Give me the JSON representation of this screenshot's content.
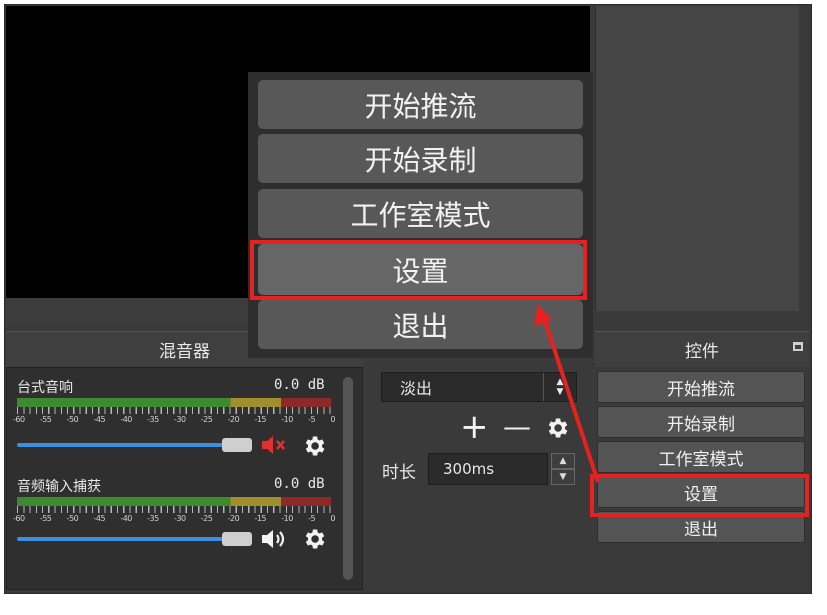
{
  "mixer": {
    "title": "混音器",
    "channels": [
      {
        "name": "台式音响",
        "db": "0.0 dB",
        "muted": true
      },
      {
        "name": "音频输入捕获",
        "db": "0.0 dB",
        "muted": false
      }
    ],
    "scale_labels": [
      "-60",
      "-55",
      "-50",
      "-45",
      "-40",
      "-35",
      "-30",
      "-25",
      "-20",
      "-15",
      "-10",
      "-5",
      "0"
    ]
  },
  "transitions": {
    "selected": "淡出",
    "add_label": "+",
    "remove_label": "—",
    "duration_label": "时长",
    "duration_value": "300ms"
  },
  "controls": {
    "title": "控件",
    "buttons": [
      "开始推流",
      "开始录制",
      "工作室模式",
      "设置",
      "退出"
    ],
    "highlighted": "设置"
  },
  "popup_menu": {
    "buttons": [
      "开始推流",
      "开始录制",
      "工作室模式",
      "设置",
      "退出"
    ],
    "highlighted": "设置"
  },
  "colors": {
    "annotation_red": "#e8201f",
    "volume_blue": "#3a8fe0",
    "mute_red": "#e03030"
  },
  "icons": [
    "mute-speaker-icon",
    "speaker-icon",
    "gear-icon",
    "chevron-up-icon",
    "chevron-down-icon",
    "float-dock-icon"
  ]
}
